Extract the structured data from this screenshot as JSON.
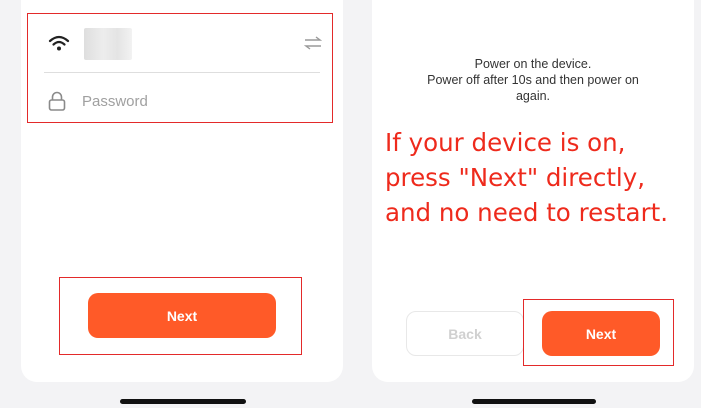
{
  "left_screen": {
    "wifi_icon": "wifi-icon",
    "switch_icon": "swap-arrows-icon",
    "lock_icon": "lock-icon",
    "password_placeholder": "Password",
    "next_label": "Next"
  },
  "right_screen": {
    "instructions": [
      "Power on the device.",
      "Power off after 10s and then power on",
      "again."
    ],
    "annotation": [
      "If your device is on,",
      "press \"Next\" directly,",
      "and no need to restart."
    ],
    "back_label": "Back",
    "next_label": "Next"
  },
  "colors": {
    "accent": "#ff5a28",
    "annotation_red": "#ee2a1c",
    "highlight_frame": "#e32a2a"
  }
}
